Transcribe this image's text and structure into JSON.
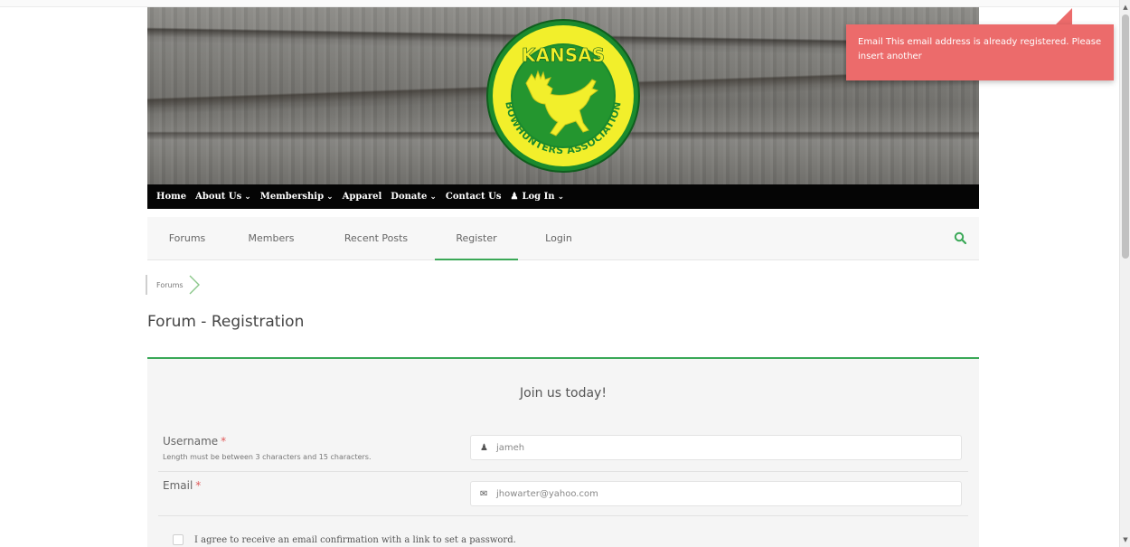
{
  "banner": {
    "logo_top_text": "KANSAS",
    "logo_ring_text": "BOWHUNTERS ASSOCIATION",
    "colors": {
      "logo_green": "#1a8a2e",
      "logo_yellow": "#f2ef2b"
    }
  },
  "main_nav": {
    "items": [
      {
        "label": "Home"
      },
      {
        "label": "About Us",
        "dropdown": true
      },
      {
        "label": "Membership",
        "dropdown": true
      },
      {
        "label": "Apparel"
      },
      {
        "label": "Donate",
        "dropdown": true
      },
      {
        "label": "Contact Us"
      },
      {
        "label": "Log In",
        "dropdown": true,
        "icon": "user-icon"
      }
    ]
  },
  "forum_nav": {
    "tabs": [
      {
        "label": "Forums"
      },
      {
        "label": "Members"
      },
      {
        "label": "Recent Posts"
      },
      {
        "label": "Register",
        "active": true
      },
      {
        "label": "Login"
      }
    ],
    "search_icon": "search-icon",
    "accent": "#3aa857"
  },
  "breadcrumb": {
    "items": [
      "Forums"
    ]
  },
  "page": {
    "title": "Forum - Registration"
  },
  "form": {
    "heading": "Join us today!",
    "username": {
      "label": "Username",
      "required_mark": "*",
      "hint": "Length must be between 3 characters and 15 characters.",
      "value": "jameh",
      "icon": "user-icon"
    },
    "email": {
      "label": "Email",
      "required_mark": "*",
      "value": "jhowarter@yahoo.com",
      "icon": "envelope-icon"
    },
    "agree": {
      "label": "I agree to receive an email confirmation with a link to set a password.",
      "checked": false
    }
  },
  "toast": {
    "message": "Email This email address is already registered. Please insert another",
    "color": "#ec6b6b"
  }
}
